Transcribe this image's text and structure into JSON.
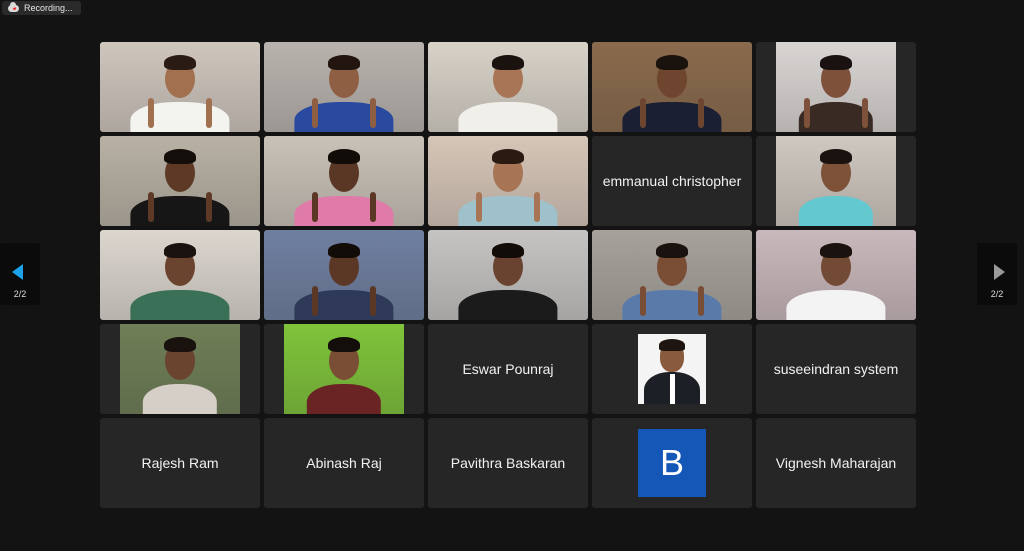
{
  "recording": {
    "label": "Recording..."
  },
  "pager": {
    "left_label": "2/2",
    "right_label": "2/2"
  },
  "tiles": [
    {
      "type": "video",
      "bg": "#cfc6bd",
      "skin": "#a0704f",
      "shirt": "#f3f3f0",
      "hair": "#2a1c14",
      "hands": true
    },
    {
      "type": "video",
      "bg": "#b9b3ae",
      "skin": "#8f5f43",
      "shirt": "#2a4aa0",
      "hair": "#221510",
      "hands": true
    },
    {
      "type": "video",
      "bg": "#d8d2c8",
      "skin": "#a87556",
      "shirt": "#f1efe9",
      "hair": "#1a120e",
      "hands": false
    },
    {
      "type": "video",
      "bg": "#8a6a4c",
      "skin": "#6e452e",
      "shirt": "#1b1f33",
      "hair": "#1a120c",
      "hands": true
    },
    {
      "type": "video",
      "bg": "#d9d5d3",
      "skin": "#7e523a",
      "shirt": "#3a2a24",
      "hair": "#1a1210",
      "hands": true,
      "narrow": true
    },
    {
      "type": "video",
      "bg": "#b8b1a4",
      "skin": "#5e3a26",
      "shirt": "#161616",
      "hair": "#140e0a",
      "hands": true
    },
    {
      "type": "video",
      "bg": "#c9c2b8",
      "skin": "#5a3725",
      "shirt": "#e07aa8",
      "hair": "#120c08",
      "hands": true
    },
    {
      "type": "video",
      "bg": "#d6c6b8",
      "skin": "#a77555",
      "shirt": "#9ec1cc",
      "hair": "#2a1a12",
      "hands": true
    },
    {
      "type": "name",
      "name": "emmanual christopher"
    },
    {
      "type": "video",
      "bg": "#cfc8c0",
      "skin": "#7d5238",
      "shirt": "#63c8cf",
      "hair": "#1a120e",
      "hands": false,
      "narrow": true
    },
    {
      "type": "video",
      "bg": "#dcd6cf",
      "skin": "#6b4430",
      "shirt": "#3b7058",
      "hair": "#1a120e",
      "hands": false
    },
    {
      "type": "video",
      "bg": "#6f7fa0",
      "skin": "#5b3826",
      "shirt": "#2f3a58",
      "hair": "#120c08",
      "hands": true
    },
    {
      "type": "video",
      "bg": "#c6c4c2",
      "skin": "#6a4330",
      "shirt": "#1b1b1b",
      "hair": "#120c08",
      "hands": false
    },
    {
      "type": "video",
      "bg": "#a7a29b",
      "skin": "#7a4d35",
      "shirt": "#5a7aaa",
      "hair": "#1a120e",
      "hands": true
    },
    {
      "type": "video",
      "bg": "#c9b8bb",
      "skin": "#734a33",
      "shirt": "#f3f3f3",
      "hair": "#1a120e",
      "hands": false
    },
    {
      "type": "video",
      "bg": "#6f7e56",
      "skin": "#6b4430",
      "shirt": "#d5cfc8",
      "hair": "#1a120e",
      "hands": false,
      "narrow": true
    },
    {
      "type": "video",
      "bg": "#7fc43a",
      "skin": "#7a4d35",
      "shirt": "#6b2424",
      "hair": "#140e0a",
      "hands": false,
      "narrow": true
    },
    {
      "type": "name",
      "name": "Eswar Pounraj"
    },
    {
      "type": "portrait"
    },
    {
      "type": "name",
      "name": "suseeindran system"
    },
    {
      "type": "name",
      "name": "Rajesh Ram"
    },
    {
      "type": "name",
      "name": "Abinash Raj"
    },
    {
      "type": "name",
      "name": "Pavithra Baskaran"
    },
    {
      "type": "avatar",
      "letter": "B",
      "color": "#1557b6"
    },
    {
      "type": "name",
      "name": "Vignesh Maharajan"
    }
  ]
}
